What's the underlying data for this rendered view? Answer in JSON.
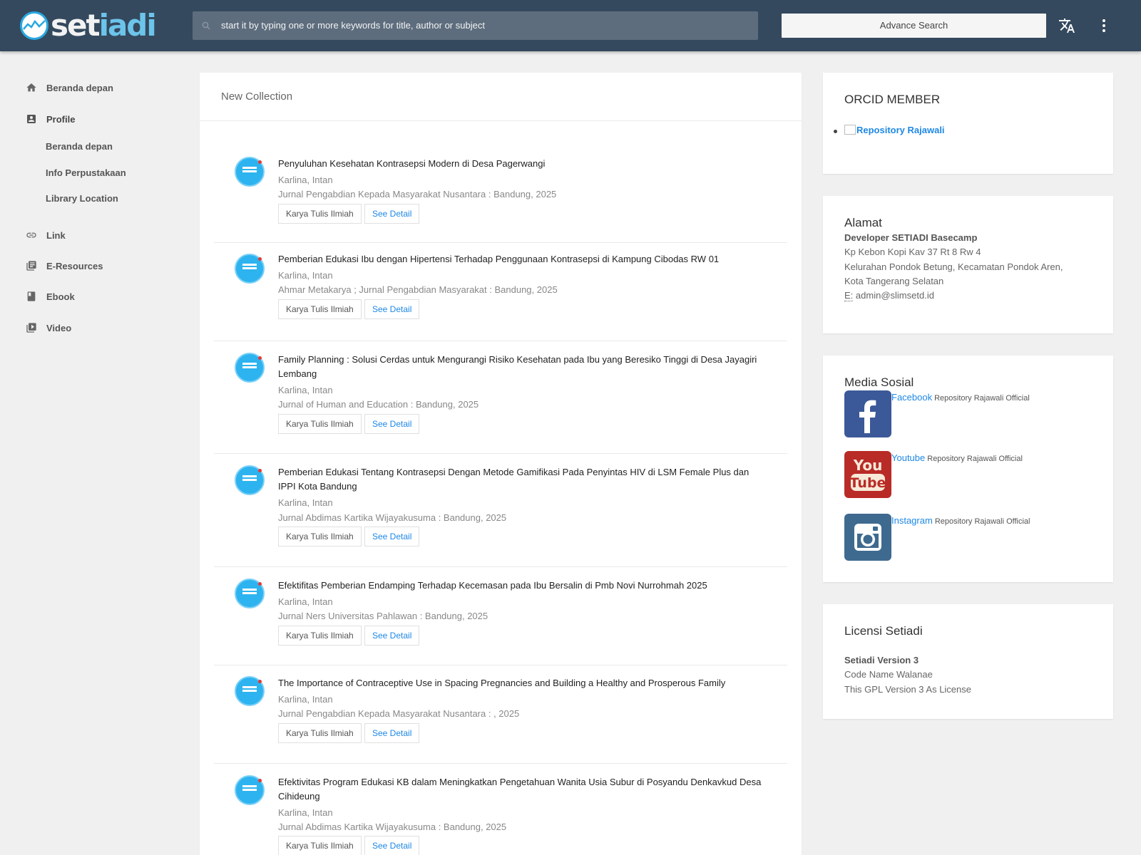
{
  "header": {
    "logo_part1": "set",
    "logo_part2": "iadi",
    "search_placeholder": "start it by typing one or more keywords for title, author or subject",
    "advance_search_label": "Advance Search"
  },
  "sidebar": {
    "items": [
      {
        "label": "Beranda depan",
        "icon": "home-icon"
      },
      {
        "label": "Profile",
        "icon": "profile-icon"
      },
      {
        "label": "Link",
        "icon": "link-icon"
      },
      {
        "label": "E-Resources",
        "icon": "library-books-icon"
      },
      {
        "label": "Ebook",
        "icon": "book-icon"
      },
      {
        "label": "Video",
        "icon": "video-library-icon"
      }
    ],
    "profile_sub": [
      "Beranda depan",
      "Info Perpustakaan",
      "Library Location"
    ]
  },
  "main": {
    "heading": "New Collection",
    "tag_label": "Karya Tulis Ilmiah",
    "detail_label": "See Detail",
    "items": [
      {
        "title": "Penyuluhan Kesehatan Kontrasepsi Modern di Desa Pagerwangi",
        "author": "Karlina, Intan",
        "publisher": "Jurnal Pengabdian Kepada Masyarakat Nusantara : Bandung, 2025"
      },
      {
        "title": "Pemberian Edukasi Ibu dengan Hipertensi Terhadap Penggunaan Kontrasepsi di Kampung Cibodas RW 01",
        "author": "Karlina, Intan",
        "publisher": "Ahmar Metakarya ; Jurnal Pengabdian Masyarakat : Bandung, 2025"
      },
      {
        "title": "Family Planning : Solusi Cerdas untuk Mengurangi Risiko Kesehatan pada Ibu yang Beresiko Tinggi di Desa Jayagiri Lembang",
        "author": "Karlina, Intan",
        "publisher": "Jurnal of Human and Education : Bandung, 2025"
      },
      {
        "title": "Pemberian Edukasi Tentang Kontrasepsi Dengan Metode Gamifikasi Pada Penyintas HIV di LSM Female Plus dan IPPI Kota Bandung",
        "author": "Karlina, Intan",
        "publisher": "Jurnal Abdimas Kartika Wijayakusuma : Bandung, 2025"
      },
      {
        "title": "Efektifitas Pemberian Endamping Terhadap Kecemasan pada Ibu Bersalin di Pmb Novi Nurrohmah 2025",
        "author": "Karlina, Intan",
        "publisher": "Jurnal Ners Universitas Pahlawan : Bandung, 2025"
      },
      {
        "title": "The Importance of Contraceptive Use in Spacing Pregnancies and Building a Healthy and Prosperous Family",
        "author": "Karlina, Intan",
        "publisher": "Jurnal Pengabdian Kepada Masyarakat Nusantara : , 2025"
      },
      {
        "title": "Efektivitas Program Edukasi KB dalam Meningkatkan Pengetahuan Wanita Usia Subur di Posyandu Denkavkud Desa Cihideung",
        "author": "Karlina, Intan",
        "publisher": "Jurnal Abdimas Kartika Wijayakusuma : Bandung, 2025"
      }
    ]
  },
  "orcid": {
    "title": "ORCID MEMBER",
    "link_label": "Repository Rajawali"
  },
  "alamat": {
    "title": "Alamat",
    "name": "Developer SETIADI Basecamp",
    "lines": [
      "Kp Kebon Kopi Kav 37 Rt 8 Rw 4",
      "Kelurahan Pondok Betung, Kecamatan Pondok Aren,",
      "Kota Tangerang Selatan"
    ],
    "email_label": "E:",
    "email": "admin@slimsetd.id"
  },
  "social": {
    "title": "Media Sosial",
    "items": [
      {
        "name": "Facebook",
        "account": "Repository Rajawali Official",
        "icon": "facebook-icon",
        "color": "#3b5998"
      },
      {
        "name": "Youtube",
        "account": "Repository Rajawali Official",
        "icon": "youtube-icon",
        "color": "#b92b27"
      },
      {
        "name": "Instagram",
        "account": "Repository Rajawali Official",
        "icon": "instagram-icon",
        "color": "#3f6a8f"
      }
    ]
  },
  "license": {
    "title": "Licensi Setiadi",
    "version": "Setiadi Version 3",
    "codename": "Code Name Walanae",
    "license": "This GPL Version 3 As License"
  },
  "colors": {
    "header": "#34495e",
    "link": "#1e88e5",
    "accent": "#2db3ef"
  }
}
